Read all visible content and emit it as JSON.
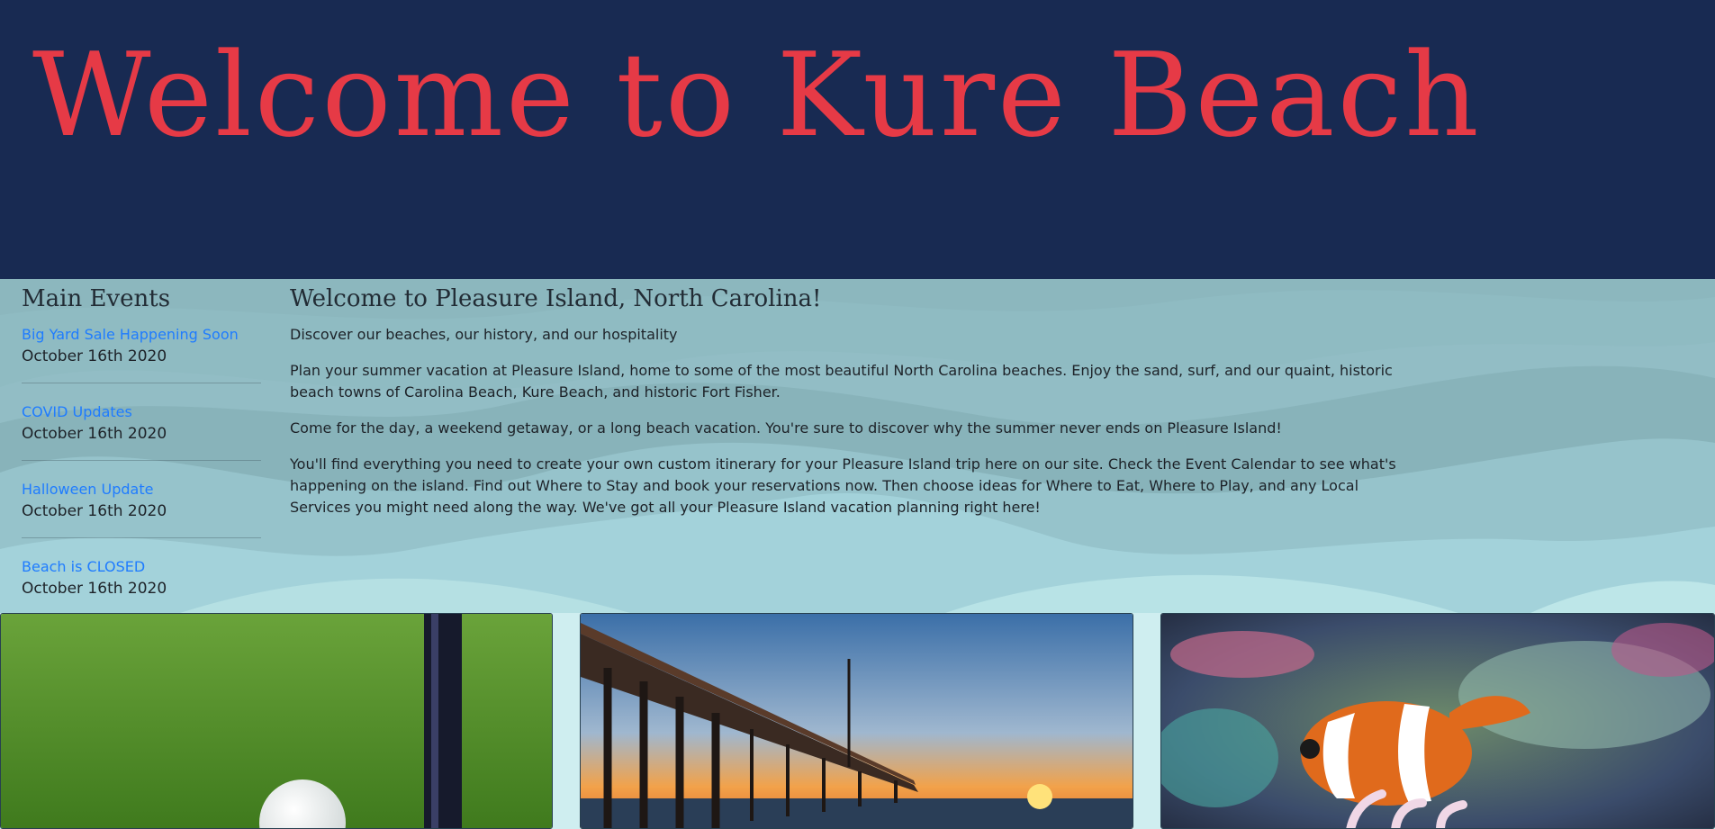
{
  "hero": {
    "title": "Welcome to Kure Beach"
  },
  "sidebar": {
    "heading": "Main Events",
    "events": [
      {
        "title": "Big Yard Sale Happening Soon",
        "date": "October 16th 2020"
      },
      {
        "title": "COVID Updates",
        "date": "October 16th 2020"
      },
      {
        "title": "Halloween Update",
        "date": "October 16th 2020"
      },
      {
        "title": "Beach is CLOSED",
        "date": "October 16th 2020"
      }
    ]
  },
  "main": {
    "heading": "Welcome to Pleasure Island, North Carolina!",
    "paragraphs": [
      "Discover our beaches, our history, and our hospitality",
      "Plan your summer vacation at Pleasure Island, home to some of the most beautiful North Carolina beaches. Enjoy the sand, surf, and our quaint, historic beach towns of Carolina Beach, Kure Beach, and historic Fort Fisher.",
      "Come for the day, a weekend getaway, or a long beach vacation. You're sure to discover why the summer never ends on Pleasure Island!",
      "You'll find everything you need to create your own custom itinerary for your Pleasure Island trip here on our site. Check the Event Calendar to see what's happening on the island. Find out Where to Stay and book your reservations now. Then choose ideas for Where to Eat, Where to Play, and any Local Services you might need along the way. We've got all your Pleasure Island vacation planning right here!"
    ]
  },
  "cards": [
    {
      "subject": "golf-ball-image"
    },
    {
      "subject": "pier-sunset-image"
    },
    {
      "subject": "clownfish-image"
    }
  ],
  "colors": {
    "hero_bg": "#182a52",
    "title": "#e63a46",
    "link": "#1f7cff",
    "content_bg": "#8db8bf"
  }
}
